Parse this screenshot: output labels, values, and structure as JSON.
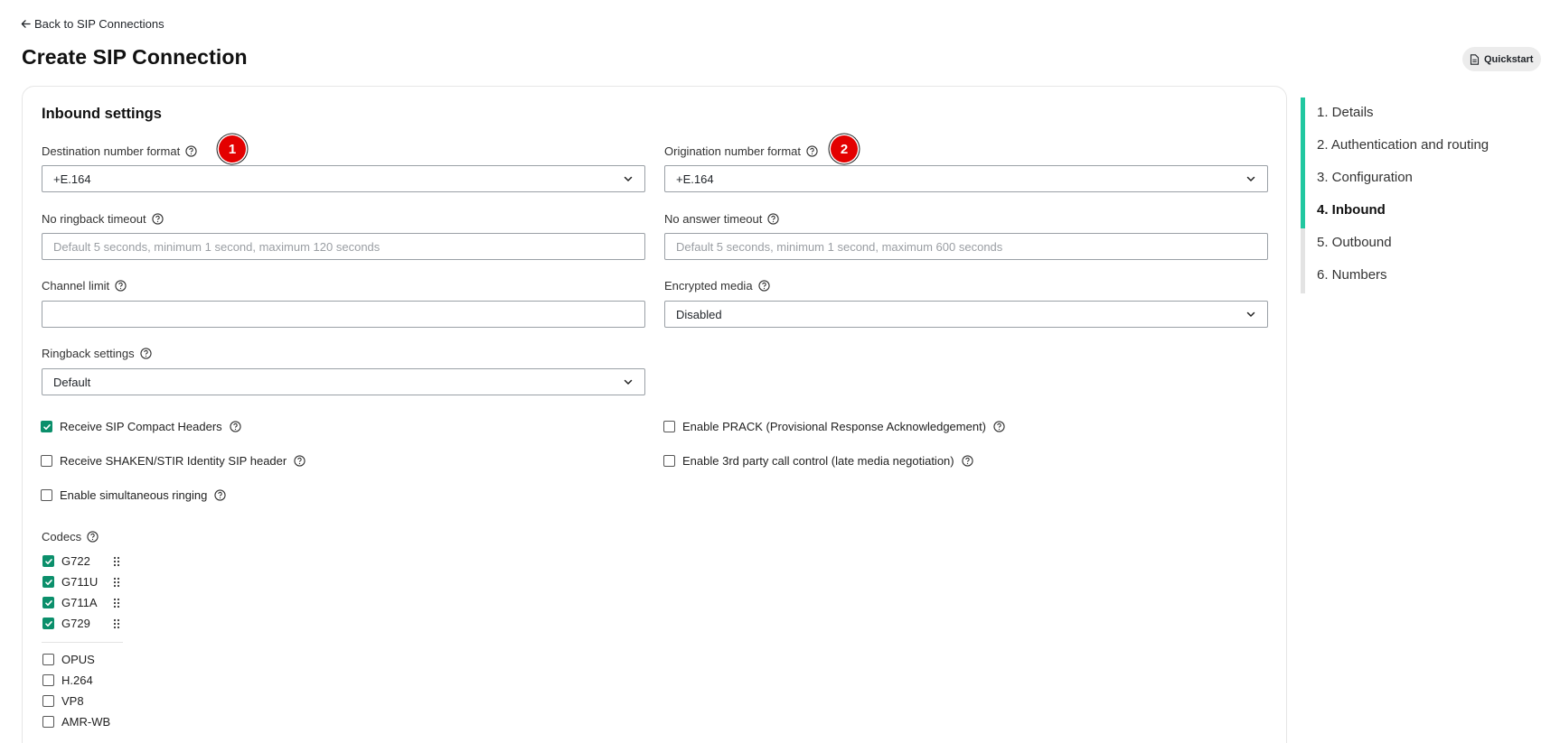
{
  "header": {
    "back_label": "Back to SIP Connections",
    "title": "Create SIP Connection",
    "quickstart_label": "Quickstart"
  },
  "section": {
    "title": "Inbound settings"
  },
  "fields": {
    "destination_format": {
      "label": "Destination number format",
      "value": "+E.164"
    },
    "origination_format": {
      "label": "Origination number format",
      "value": "+E.164"
    },
    "no_ringback_timeout": {
      "label": "No ringback timeout",
      "placeholder": "Default 5 seconds, minimum 1 second, maximum 120 seconds"
    },
    "no_answer_timeout": {
      "label": "No answer timeout",
      "placeholder": "Default 5 seconds, minimum 1 second, maximum 600 seconds"
    },
    "channel_limit": {
      "label": "Channel limit",
      "value": ""
    },
    "encrypted_media": {
      "label": "Encrypted media",
      "value": "Disabled"
    },
    "ringback_settings": {
      "label": "Ringback settings",
      "value": "Default"
    }
  },
  "badges": {
    "one": "1",
    "two": "2"
  },
  "checkboxes": {
    "compact_headers": {
      "label": "Receive SIP Compact Headers",
      "checked": true
    },
    "shaken_stir": {
      "label": "Receive SHAKEN/STIR Identity SIP header",
      "checked": false
    },
    "simultaneous_ringing": {
      "label": "Enable simultaneous ringing",
      "checked": false
    },
    "prack": {
      "label": "Enable PRACK (Provisional Response Acknowledgement)",
      "checked": false
    },
    "third_party": {
      "label": "Enable 3rd party call control (late media negotiation)",
      "checked": false
    }
  },
  "codecs": {
    "label": "Codecs",
    "enabled": [
      "G722",
      "G711U",
      "G711A",
      "G729"
    ],
    "disabled": [
      "OPUS",
      "H.264",
      "VP8",
      "AMR-WB"
    ]
  },
  "steps": [
    {
      "label": "1. Details"
    },
    {
      "label": "2. Authentication and routing"
    },
    {
      "label": "3. Configuration"
    },
    {
      "label": "4. Inbound",
      "active": true
    },
    {
      "label": "5. Outbound"
    },
    {
      "label": "6. Numbers"
    }
  ],
  "colors": {
    "accent": "#21c7a0",
    "check": "#0b8f6b",
    "badge": "#e30000"
  }
}
